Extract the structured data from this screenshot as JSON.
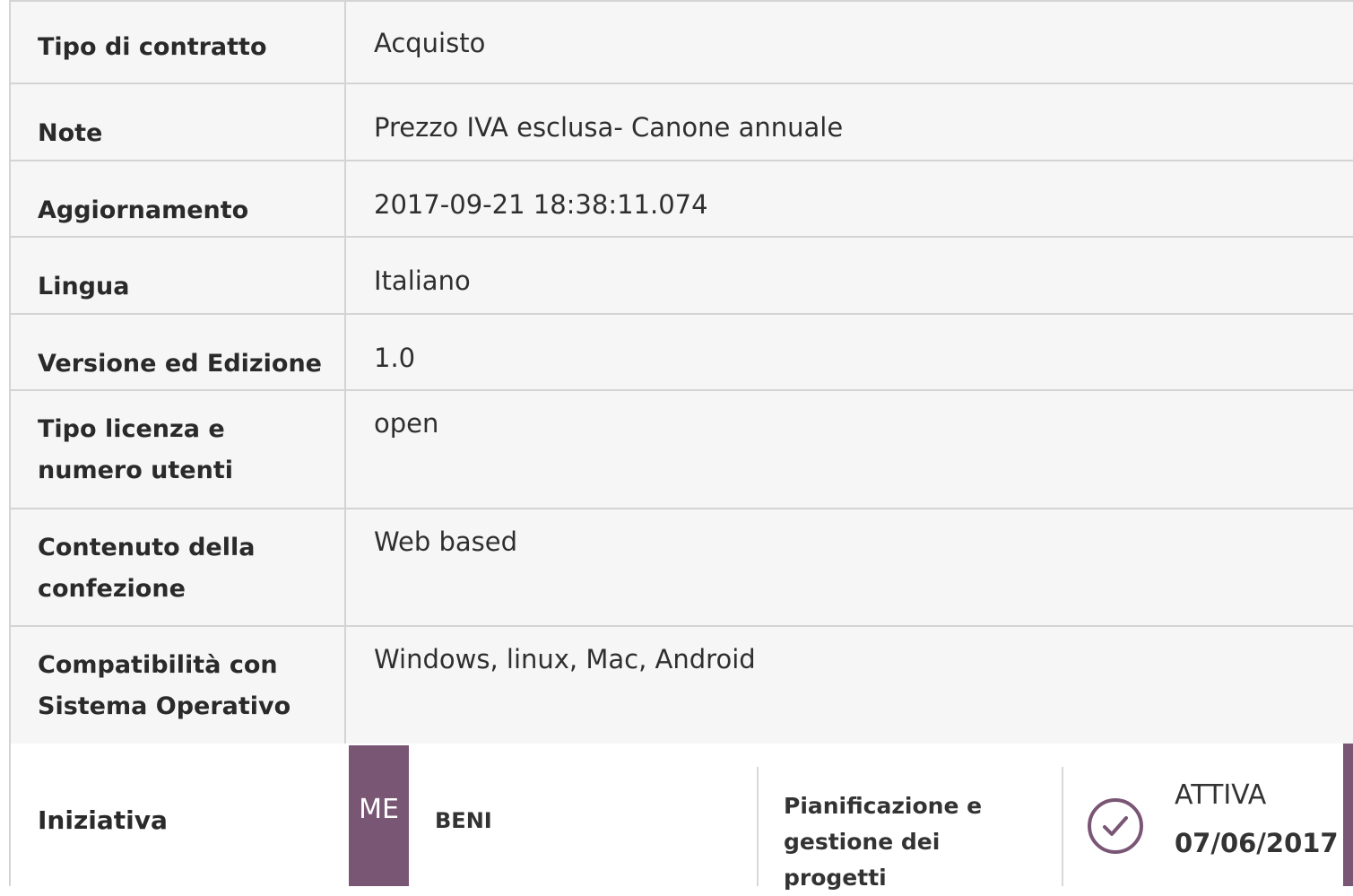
{
  "rows": [
    {
      "label": "Tipo di contratto",
      "value": "Acquisto"
    },
    {
      "label": "Note",
      "value": "Prezzo IVA   esclusa- Canone annuale"
    },
    {
      "label": "Aggiornamento",
      "value": "2017-09-21 18:38:11.074"
    },
    {
      "label": "Lingua",
      "value": "Italiano"
    },
    {
      "label": "Versione ed Edizione",
      "value": "1.0"
    },
    {
      "label": "Tipo licenza e numero utenti",
      "value": "open"
    },
    {
      "label": "Contenuto della confezione",
      "value": "Web based"
    },
    {
      "label": "Compatibilità con Sistema Operativo",
      "value": "Windows, linux,  Mac,  Android"
    }
  ],
  "iniziativa": {
    "label": "Iniziativa",
    "badge": "ME",
    "category": "BENI",
    "area": "Pianificazione e gestione dei progetti",
    "status": "ATTIVA",
    "date": "07/06/2017",
    "icon": "check-circle-icon",
    "accent_color": "#7a5675"
  }
}
